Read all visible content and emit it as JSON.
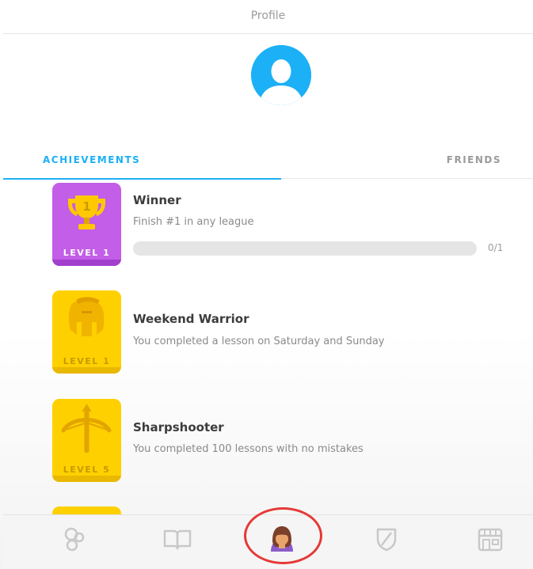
{
  "header": {
    "title": "Profile"
  },
  "tabs": [
    {
      "label": "ACHIEVEMENTS",
      "active": true
    },
    {
      "label": "FRIENDS",
      "active": false
    }
  ],
  "achievements": [
    {
      "title": "Winner",
      "description": "Finish #1 in any league",
      "level": "LEVEL 1",
      "badge_color": "#c25ee7",
      "icon": "trophy-icon",
      "progress_text": "0/1",
      "progress_fraction": 0
    },
    {
      "title": "Weekend Warrior",
      "description": "You completed a lesson on Saturday and Sunday",
      "level": "LEVEL 1",
      "badge_color": "#ffd000",
      "icon": "spartan-helmet-icon"
    },
    {
      "title": "Sharpshooter",
      "description": "You completed 100 lessons with no mistakes",
      "level": "LEVEL 5",
      "badge_color": "#ffd000",
      "icon": "crossbow-icon"
    }
  ],
  "nav": [
    {
      "icon": "learn-icon",
      "active": false
    },
    {
      "icon": "stories-icon",
      "active": false
    },
    {
      "icon": "profile-icon",
      "active": true,
      "highlighted": true
    },
    {
      "icon": "leagues-shield-icon",
      "active": false
    },
    {
      "icon": "shop-icon",
      "active": false
    }
  ],
  "colors": {
    "accent": "#1cb0f6",
    "highlight_ring": "#e53935",
    "purple_badge": "#c25ee7",
    "gold_badge": "#ffd000"
  }
}
